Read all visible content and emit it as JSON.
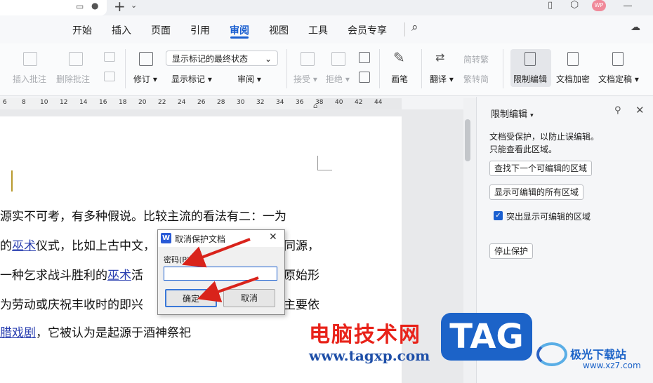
{
  "menu": {
    "items": [
      "开始",
      "插入",
      "页面",
      "引用",
      "审阅",
      "视图",
      "工具",
      "会员专享"
    ],
    "active": "审阅",
    "avatar": "WP"
  },
  "ribbon": {
    "insert_comment": "插入批注",
    "delete_comment": "删除批注",
    "revise": "修订",
    "markup_state": "显示标记的最终状态",
    "show_markup": "显示标记",
    "review": "审阅",
    "accept": "接受",
    "reject": "拒绝",
    "pen": "画笔",
    "translate": "翻译",
    "to_traditional": "简转繁",
    "to_simplified": "繁转简",
    "restrict_edit": "限制编辑",
    "doc_encrypt": "文档加密",
    "doc_finalize": "文档定稿"
  },
  "ruler": {
    "ticks": [
      "6",
      "8",
      "10",
      "12",
      "14",
      "16",
      "18",
      "20",
      "22",
      "24",
      "26",
      "28",
      "30",
      "32",
      "34",
      "36",
      "38",
      "40",
      "42",
      "44"
    ]
  },
  "document": {
    "line1": "源实不可考，有多种假说。比较主流的看法有二：一为",
    "line2_a": "的",
    "line2_link": "巫术",
    "line2_b": "仪式，比如上古中文，",
    "line2_c": "同源，",
    "line3_a": "一种乞求战斗胜利的",
    "line3_link": "巫术",
    "line3_b": "活",
    "line3_c": "原始形",
    "line4_a": "为劳动或庆祝丰收时的即兴",
    "line4_c": "主要依",
    "line5_link": "腊戏剧",
    "line5_b": "，它被认为是起源于酒神祭祀"
  },
  "panel": {
    "title": "限制编辑",
    "desc1": "文档受保护，以防止误编辑。",
    "desc2": "只能查看此区域。",
    "find_next": "查找下一个可编辑的区域",
    "show_all": "显示可编辑的所有区域",
    "highlight_label": "突出显示可编辑的区域",
    "highlight_checked": true,
    "stop_protect": "停止保护"
  },
  "dialog": {
    "title": "取消保护文档",
    "password_label": "密码(P)",
    "password_value": "",
    "ok": "确定",
    "cancel": "取消"
  },
  "watermark": {
    "cn": "电脑技术网",
    "url": "www.tagxp.com",
    "logo": "TAG",
    "site": "极光下载站",
    "site_url": "www.xz7.com"
  },
  "colors": {
    "accent": "#1a5fd0",
    "arrow": "#d9231b",
    "link": "#2a3fb0"
  }
}
